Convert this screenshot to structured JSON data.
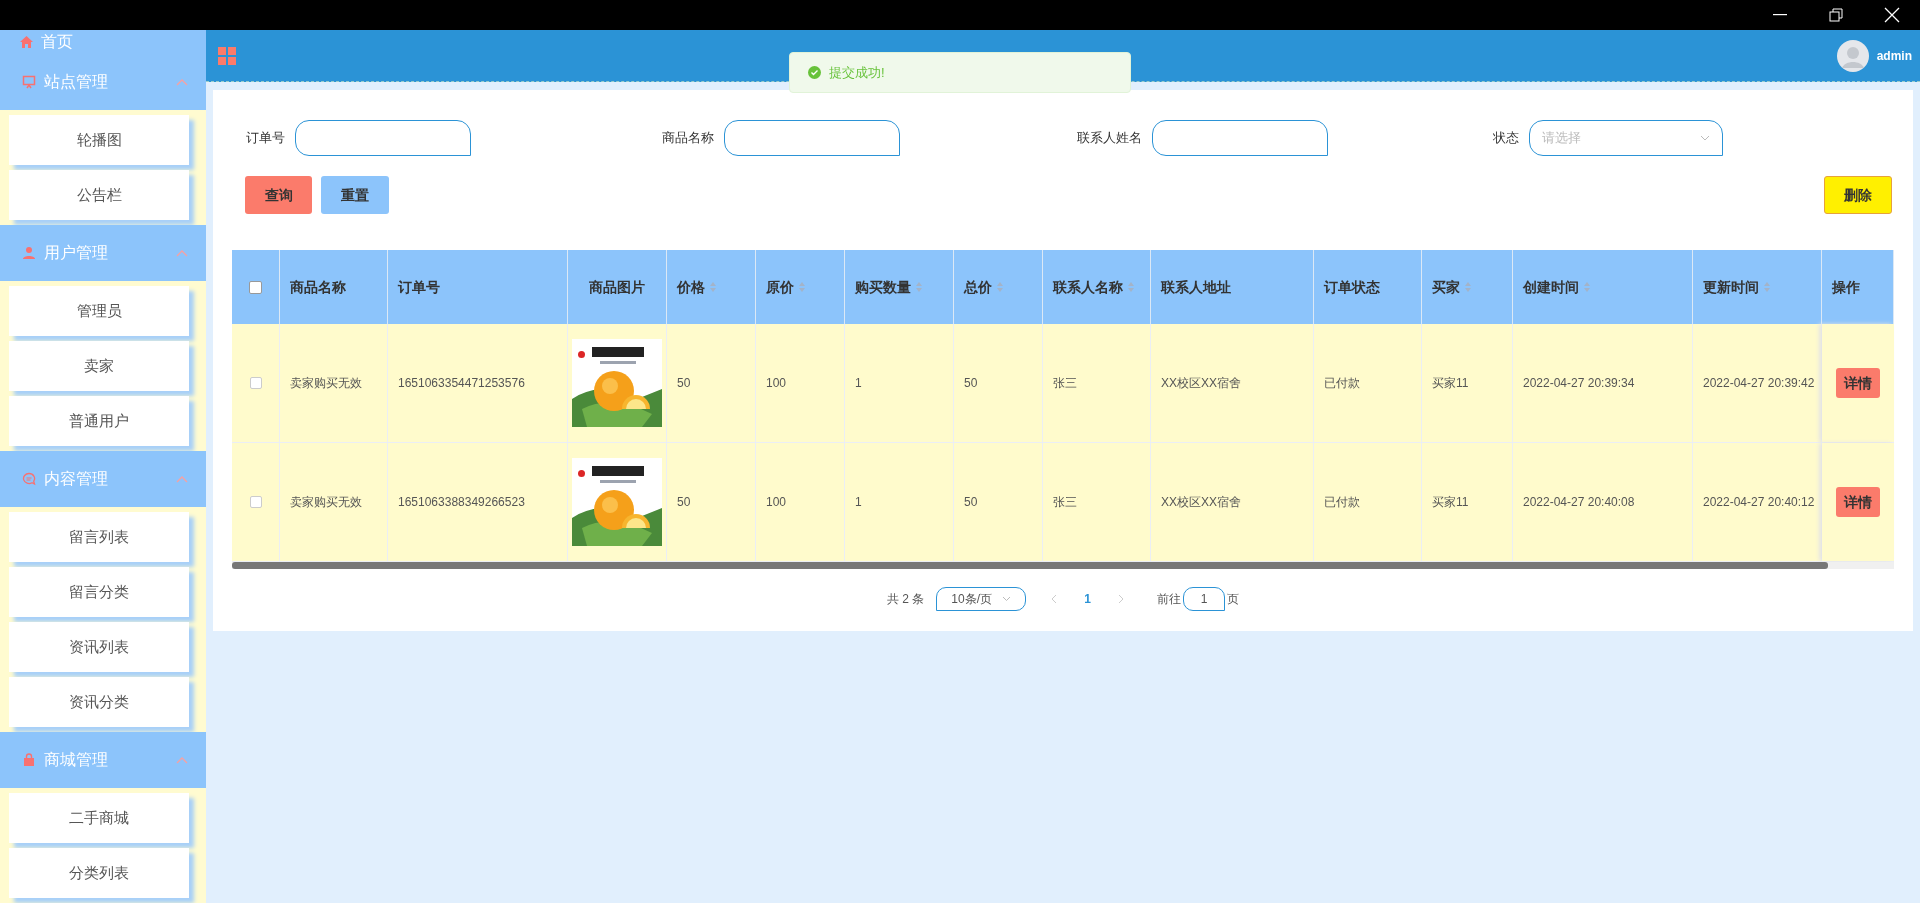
{
  "sidebar": {
    "home": "首页",
    "groups": [
      {
        "title": "站点管理",
        "expanded": true,
        "items": [
          "轮播图",
          "公告栏"
        ]
      },
      {
        "title": "用户管理",
        "expanded": true,
        "items": [
          "管理员",
          "卖家",
          "普通用户"
        ]
      },
      {
        "title": "内容管理",
        "expanded": true,
        "items": [
          "留言列表",
          "留言分类",
          "资讯列表",
          "资讯分类"
        ]
      },
      {
        "title": "商城管理",
        "expanded": true,
        "items": [
          "二手商城",
          "分类列表"
        ]
      }
    ]
  },
  "header": {
    "user": "admin"
  },
  "toast": {
    "message": "提交成功!"
  },
  "filters": [
    {
      "label": "订单号",
      "kind": "input"
    },
    {
      "label": "商品名称",
      "kind": "input"
    },
    {
      "label": "联系人姓名",
      "kind": "input"
    },
    {
      "label": "状态",
      "kind": "select",
      "placeholder": "请选择"
    }
  ],
  "buttons": {
    "search": "查询",
    "reset": "重置",
    "delete": "删除"
  },
  "table": {
    "select_all_checked": false,
    "columns": [
      {
        "label": "商品名称",
        "sortable": false
      },
      {
        "label": "订单号",
        "sortable": false
      },
      {
        "label": "商品图片",
        "sortable": false
      },
      {
        "label": "价格",
        "sortable": true
      },
      {
        "label": "原价",
        "sortable": true
      },
      {
        "label": "购买数量",
        "sortable": true
      },
      {
        "label": "总价",
        "sortable": true
      },
      {
        "label": "联系人名称",
        "sortable": true
      },
      {
        "label": "联系人地址",
        "sortable": false
      },
      {
        "label": "订单状态",
        "sortable": false
      },
      {
        "label": "买家",
        "sortable": true
      },
      {
        "label": "创建时间",
        "sortable": true
      },
      {
        "label": "更新时间",
        "sortable": true
      },
      {
        "label": "操作",
        "sortable": false
      }
    ],
    "rows": [
      {
        "checked": false,
        "cells": [
          "卖家购买无效",
          "1651063354471253576",
          "",
          "50",
          "100",
          "1",
          "50",
          "张三",
          "XX校区XX宿舍",
          "已付款",
          "买家11",
          "2022-04-27 20:39:34",
          "2022-04-27 20:39:42"
        ],
        "action": "详情"
      },
      {
        "checked": false,
        "cells": [
          "卖家购买无效",
          "1651063388349266523",
          "",
          "50",
          "100",
          "1",
          "50",
          "张三",
          "XX校区XX宿舍",
          "已付款",
          "买家11",
          "2022-04-27 20:40:08",
          "2022-04-27 20:40:12"
        ],
        "action": "详情"
      }
    ]
  },
  "pagination": {
    "total": "共 2 条",
    "page_size": "10条/页",
    "current": "1",
    "goto_label": "前往",
    "goto_value": "1",
    "page_suffix": "页"
  }
}
